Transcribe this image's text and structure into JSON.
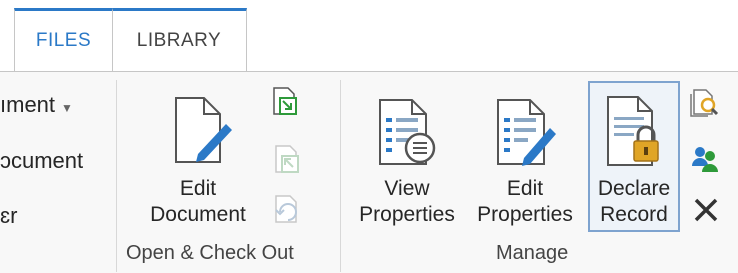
{
  "tabs": [
    {
      "label": "FILES",
      "active": true
    },
    {
      "label": "LIBRARY",
      "active": false
    }
  ],
  "left_menu": [
    {
      "label": "ıment",
      "has_dropdown": true
    },
    {
      "label": "ɔcument",
      "has_dropdown": false
    },
    {
      "label": "ɛr",
      "has_dropdown": false
    }
  ],
  "groups": {
    "open_checkout": {
      "label": "Open & Check Out",
      "edit_document": {
        "line1": "Edit",
        "line2": "Document"
      },
      "small_icons": [
        "check-out-icon",
        "check-in-icon",
        "discard-check-out-icon"
      ]
    },
    "manage": {
      "label": "Manage",
      "view_properties": {
        "line1": "View",
        "line2": "Properties"
      },
      "edit_properties": {
        "line1": "Edit",
        "line2": "Properties"
      },
      "declare_record": {
        "line1": "Declare",
        "line2": "Record"
      },
      "small_icons": [
        "version-history-icon",
        "shared-with-icon",
        "delete-icon"
      ]
    }
  },
  "colors": {
    "accent": "#2b79c7",
    "ribbon_bg": "#f8f8f8",
    "selected_border": "#7ea3cf",
    "check_green": "#2e9a3a",
    "lock_gold": "#e0a526"
  }
}
